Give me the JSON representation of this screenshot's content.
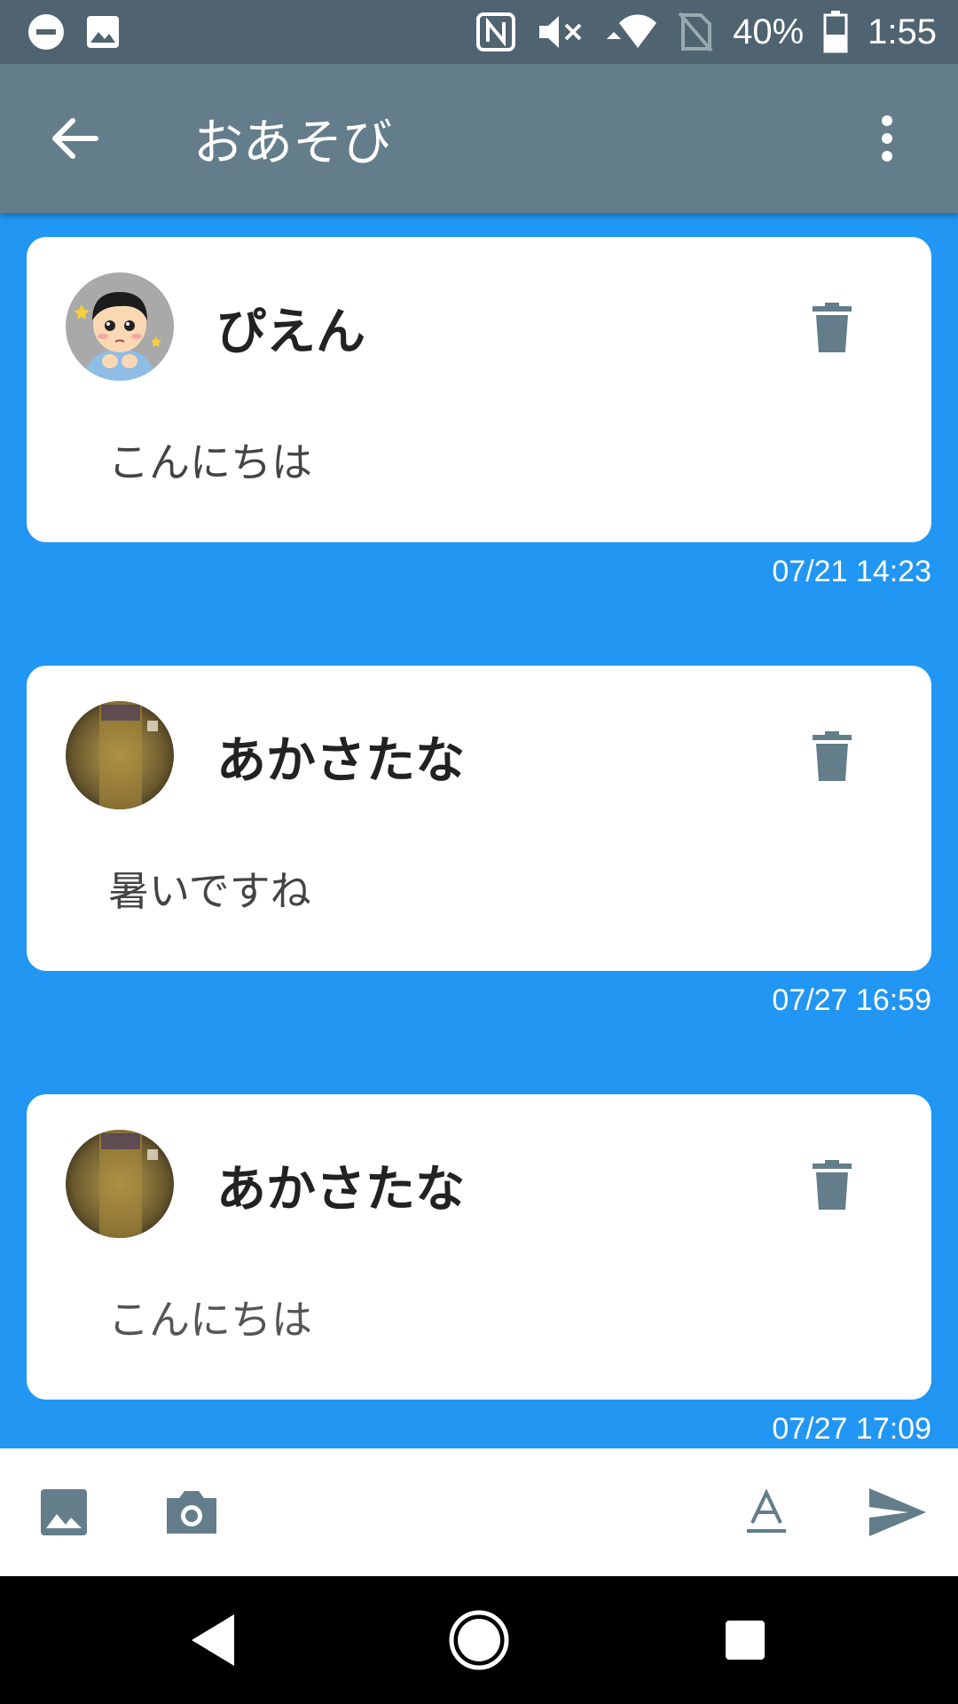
{
  "status_bar": {
    "battery_percent": "40%",
    "time": "1:55",
    "icons": [
      "minus-circle-icon",
      "image-icon",
      "nfc-icon",
      "volume-muted-icon",
      "wifi-icon",
      "no-sim-icon",
      "battery-icon"
    ]
  },
  "app_bar": {
    "title": "おあそび",
    "back_icon": "arrow-left-icon",
    "menu_icon": "more-vert-icon",
    "background": "#637d8b"
  },
  "messages": [
    {
      "username": "ぴえん",
      "text": "こんにちは",
      "timestamp": "07/21 14:23",
      "avatar": "cartoon-boy-avatar"
    },
    {
      "username": "あかさたな",
      "text": "暑いですね",
      "timestamp": "07/27 16:59",
      "avatar": "photo-avatar"
    },
    {
      "username": "あかさたな",
      "text": "こんにちは",
      "timestamp": "07/27 17:09",
      "avatar": "photo-avatar"
    }
  ],
  "input_bar": {
    "icons": [
      "gallery-icon",
      "camera-icon",
      "font-style-icon",
      "send-icon"
    ]
  },
  "nav_bar": {
    "icons": [
      "nav-back-icon",
      "nav-home-icon",
      "nav-recents-icon"
    ]
  },
  "colors": {
    "accent": "#2196f3",
    "status_bar": "#4f6370",
    "icon_gray": "#637d8b"
  }
}
